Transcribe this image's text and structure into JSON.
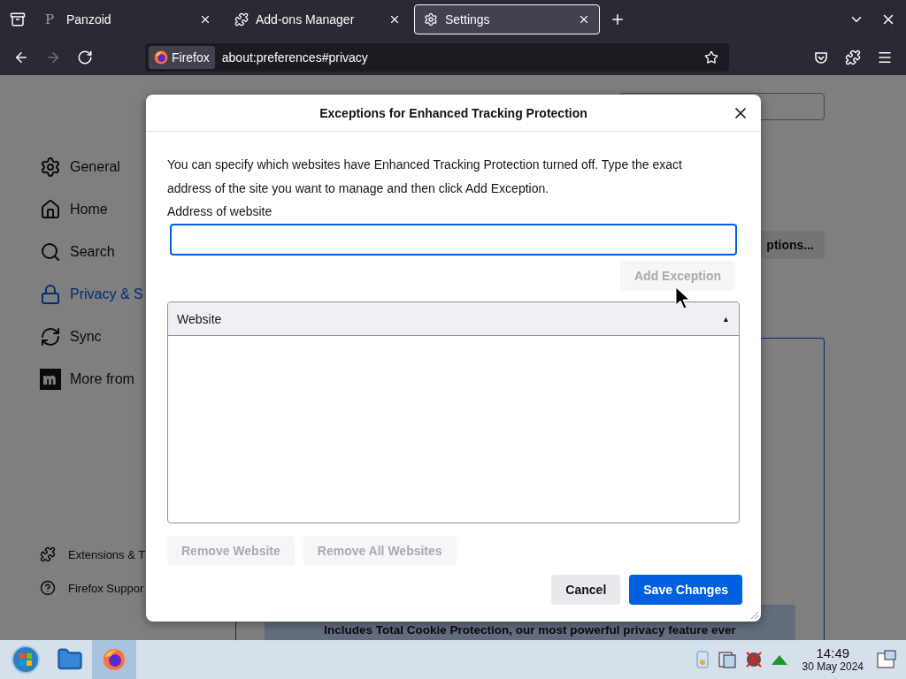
{
  "tabs": [
    {
      "label": "Panzoid",
      "kind": "site",
      "favicon": "P",
      "selected": false
    },
    {
      "label": "Add-ons Manager",
      "kind": "addons",
      "selected": false
    },
    {
      "label": "Settings",
      "kind": "settings",
      "selected": true
    }
  ],
  "toolbar": {
    "identity": "Firefox",
    "url": "about:preferences#privacy"
  },
  "sidebar": {
    "items": [
      {
        "label": "General",
        "kind": "general",
        "selected": false
      },
      {
        "label": "Home",
        "kind": "home",
        "selected": false
      },
      {
        "label": "Search",
        "kind": "search",
        "selected": false
      },
      {
        "label": "Privacy & S",
        "kind": "privacy",
        "selected": true
      },
      {
        "label": "Sync",
        "kind": "sync",
        "selected": false
      },
      {
        "label": "More from",
        "kind": "mozilla",
        "selected": false
      }
    ],
    "footer": [
      {
        "label": "Extensions & T",
        "kind": "extensions"
      },
      {
        "label": "Firefox Suppor",
        "kind": "support"
      }
    ]
  },
  "page": {
    "options_button": "ptions...",
    "banner": "Includes Total Cookie Protection, our most powerful privacy feature ever"
  },
  "dialog": {
    "title": "Exceptions for Enhanced Tracking Protection",
    "description": "You can specify which websites have Enhanced Tracking Protection turned off. Type the exact address of the site you want to manage and then click Add Exception.",
    "address_label": "Address of website",
    "add_button": {
      "label": "Add Exception",
      "disabled": true
    },
    "table": {
      "columns": [
        {
          "label": "Website",
          "sort_indicator": "▲"
        }
      ]
    },
    "remove_buttons": [
      {
        "label": "Remove Website",
        "disabled": true
      },
      {
        "label": "Remove All Websites",
        "disabled": true
      }
    ],
    "cancel": "Cancel",
    "save": "Save Changes"
  },
  "taskbar": {
    "apps": [
      {
        "kind": "folder",
        "active": false
      },
      {
        "kind": "firefox",
        "active": true
      }
    ],
    "time": "14:49",
    "date": "30 May 2024"
  }
}
